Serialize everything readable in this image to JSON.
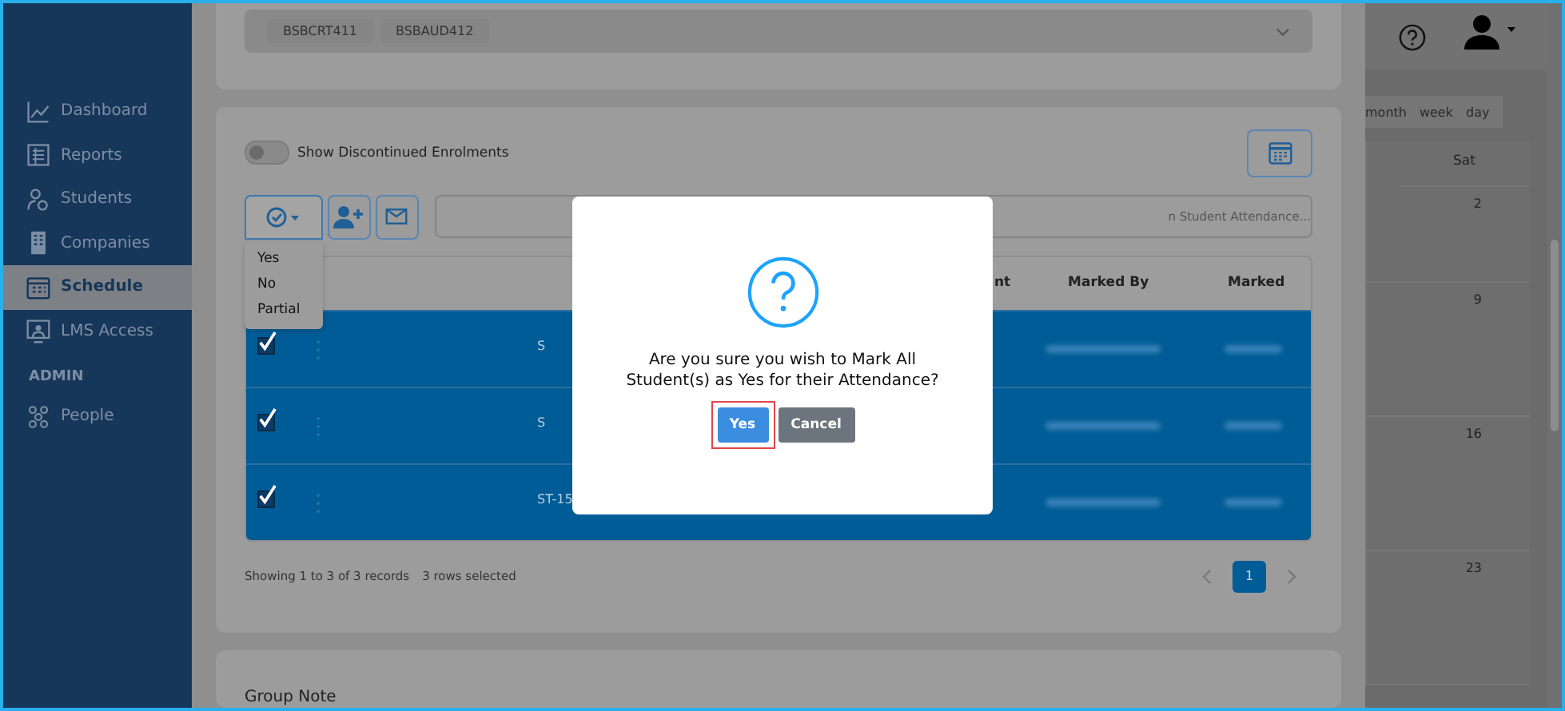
{
  "sidebar": {
    "items": [
      {
        "label": "Dashboard",
        "selected": false
      },
      {
        "label": "Reports",
        "selected": false
      },
      {
        "label": "Students",
        "selected": false
      },
      {
        "label": "Companies",
        "selected": false
      },
      {
        "label": "Schedule",
        "selected": true
      },
      {
        "label": "LMS Access",
        "selected": false
      }
    ],
    "section": "ADMIN",
    "admin_items": [
      {
        "label": "People",
        "selected": false
      }
    ]
  },
  "units_select": {
    "tags": [
      "BSBCRT411",
      "BSBAUD412"
    ]
  },
  "attendance": {
    "toggle": {
      "label": "Show Discontinued Enrolments",
      "on": false
    },
    "mark_menu": {
      "expanded": true,
      "options": [
        "Yes",
        "No",
        "Partial"
      ]
    },
    "search": {
      "placeholder": "n Student Attendance..."
    },
    "columns": [
      "nt",
      "Marked By",
      "Marked"
    ],
    "rows": [
      {
        "checked": true,
        "selected": true,
        "id": "S"
      },
      {
        "checked": true,
        "selected": true,
        "id": "S"
      },
      {
        "checked": true,
        "selected": true,
        "id": "ST-15"
      }
    ],
    "footer": {
      "records": "Showing 1 to 3 of 3 records",
      "selection": "3 rows selected"
    },
    "pages": [
      {
        "label": "1",
        "selected": true
      }
    ]
  },
  "group_note": {
    "title": "Group Note"
  },
  "calendar": {
    "views": [
      "month",
      "week",
      "day"
    ],
    "header": "Sat",
    "days": [
      "2",
      "9",
      "16",
      "23"
    ]
  },
  "dialog": {
    "message": "Are you sure you wish to Mark All Student(s) as Yes for their Attendance?",
    "buttons": [
      {
        "label": "Yes",
        "kind": "primary",
        "highlighted": true
      },
      {
        "label": "Cancel",
        "kind": "secondary",
        "highlighted": false
      }
    ]
  }
}
